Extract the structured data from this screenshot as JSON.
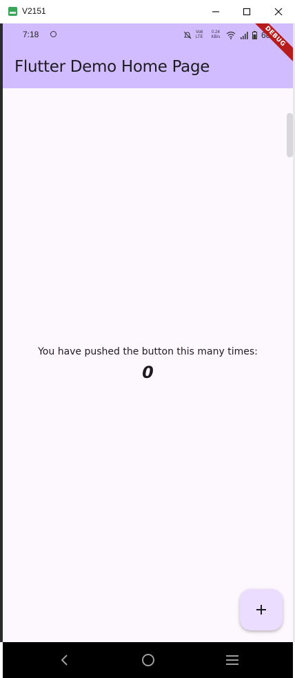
{
  "window": {
    "title": "V2151"
  },
  "status_bar": {
    "time": "7:18",
    "volte_label": "Vo8 LTE",
    "net_speed": "0.24 KB/s",
    "battery": "68"
  },
  "app_bar": {
    "title": "Flutter Demo Home Page",
    "color": "#d0bcff"
  },
  "debug_banner": {
    "label": "DEBUG"
  },
  "body": {
    "counter_label": "You have pushed the button this many times:",
    "counter_value": "0",
    "background": "#fdf7fe"
  },
  "fab": {
    "icon": "plus-icon",
    "color": "#eaddff"
  },
  "nav_bar": {
    "icons": [
      "back-icon",
      "home-icon",
      "recents-icon"
    ]
  }
}
